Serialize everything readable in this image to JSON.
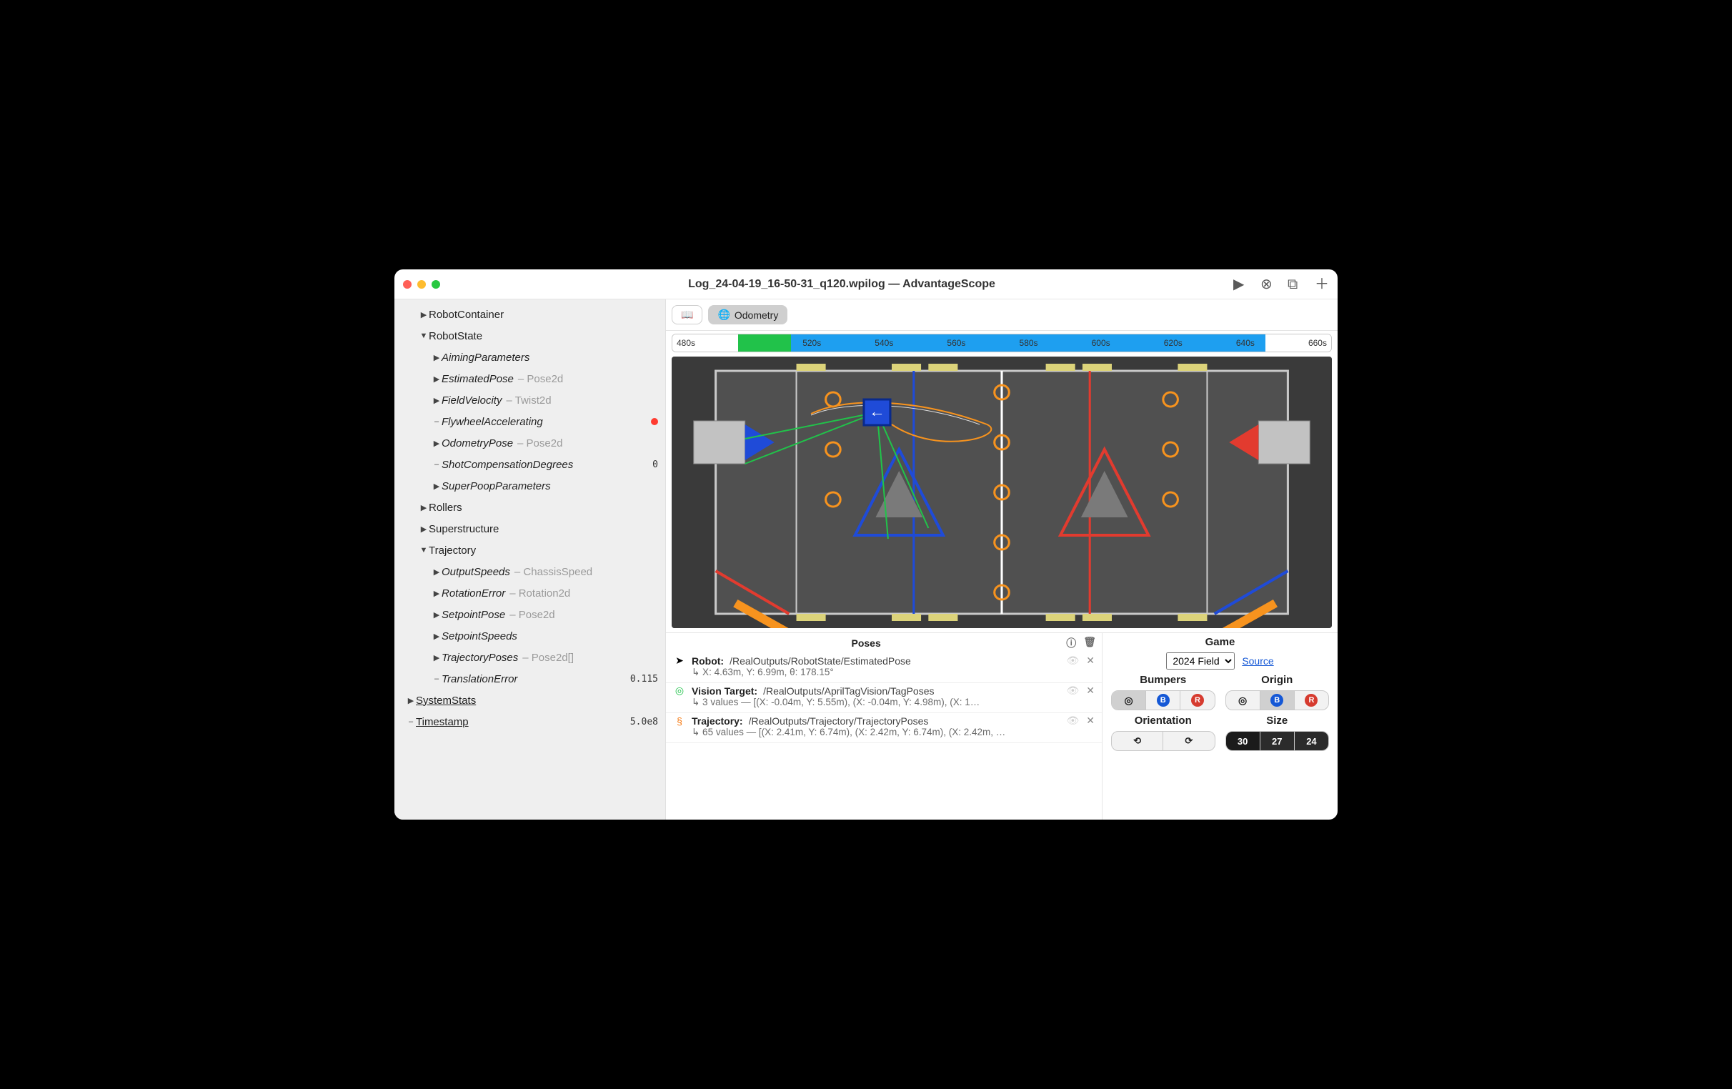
{
  "title": "Log_24-04-19_16-50-31_q120.wpilog — AdvantageScope",
  "tabs": {
    "graph": "📈",
    "odometry": "Odometry"
  },
  "timeline": {
    "ticks": [
      "480s",
      "",
      "520s",
      "540s",
      "560s",
      "580s",
      "600s",
      "620s",
      "640s",
      "660s"
    ],
    "regions": [
      {
        "start_pct": 0,
        "width_pct": 10,
        "color": "#ffffff"
      },
      {
        "start_pct": 10,
        "width_pct": 8,
        "color": "#21c24a"
      },
      {
        "start_pct": 18,
        "width_pct": 72,
        "color": "#1e9ff0"
      },
      {
        "start_pct": 90,
        "width_pct": 10,
        "color": "#ffffff"
      }
    ]
  },
  "sidebar": [
    {
      "indent": 1,
      "caret": "▶",
      "label": "RobotContainer"
    },
    {
      "indent": 1,
      "caret": "▼",
      "label": "RobotState"
    },
    {
      "indent": 2,
      "caret": "▶",
      "label": "AimingParameters",
      "italic": true
    },
    {
      "indent": 2,
      "caret": "▶",
      "label": "EstimatedPose",
      "italic": true,
      "type": "Pose2d"
    },
    {
      "indent": 2,
      "caret": "▶",
      "label": "FieldVelocity",
      "italic": true,
      "type": "Twist2d"
    },
    {
      "indent": 2,
      "caret": "–",
      "label": "FlywheelAccelerating",
      "italic": true,
      "dot": true
    },
    {
      "indent": 2,
      "caret": "▶",
      "label": "OdometryPose",
      "italic": true,
      "type": "Pose2d"
    },
    {
      "indent": 2,
      "caret": "–",
      "label": "ShotCompensationDegrees",
      "italic": true,
      "value": "0"
    },
    {
      "indent": 2,
      "caret": "▶",
      "label": "SuperPoopParameters",
      "italic": true
    },
    {
      "indent": 1,
      "caret": "▶",
      "label": "Rollers"
    },
    {
      "indent": 1,
      "caret": "▶",
      "label": "Superstructure"
    },
    {
      "indent": 1,
      "caret": "▼",
      "label": "Trajectory"
    },
    {
      "indent": 2,
      "caret": "▶",
      "label": "OutputSpeeds",
      "italic": true,
      "type": "ChassisSpeed"
    },
    {
      "indent": 2,
      "caret": "▶",
      "label": "RotationError",
      "italic": true,
      "type": "Rotation2d"
    },
    {
      "indent": 2,
      "caret": "▶",
      "label": "SetpointPose",
      "italic": true,
      "type": "Pose2d"
    },
    {
      "indent": 2,
      "caret": "▶",
      "label": "SetpointSpeeds",
      "italic": true
    },
    {
      "indent": 2,
      "caret": "▶",
      "label": "TrajectoryPoses",
      "italic": true,
      "type": "Pose2d[]"
    },
    {
      "indent": 2,
      "caret": "–",
      "label": "TranslationError",
      "italic": true,
      "value": "0.115"
    },
    {
      "indent": 0,
      "caret": "▶",
      "label": "SystemStats",
      "underline": true
    },
    {
      "indent": 0,
      "caret": "–",
      "label": "Timestamp",
      "underline": true,
      "value": "5.0e8"
    }
  ],
  "poses": {
    "title": "Poses",
    "rows": [
      {
        "icon": "➤",
        "icon_color": "#000",
        "name": "Robot:",
        "path": "/RealOutputs/RobotState/EstimatedPose",
        "sub": "↳ X: 4.63m, Y: 6.99m, θ: 178.15°"
      },
      {
        "icon": "◎",
        "icon_color": "#21c24a",
        "name": "Vision Target:",
        "path": "/RealOutputs/AprilTagVision/TagPoses",
        "sub": "↳ 3 values — [(X: -0.04m, Y: 5.55m), (X: -0.04m, Y: 4.98m), (X: 1…"
      },
      {
        "icon": "§",
        "icon_color": "#f77f1b",
        "name": "Trajectory:",
        "path": "/RealOutputs/Trajectory/TrajectoryPoses",
        "sub": "↳ 65 values — [(X: 2.41m, Y: 6.74m), (X: 2.42m, Y: 6.74m), (X: 2.42m, …"
      }
    ]
  },
  "game": {
    "title": "Game",
    "field": "2024 Field",
    "source": "Source",
    "bumpers_label": "Bumpers",
    "origin_label": "Origin",
    "orientation_label": "Orientation",
    "size_label": "Size",
    "sizes": [
      "30",
      "27",
      "24"
    ]
  }
}
